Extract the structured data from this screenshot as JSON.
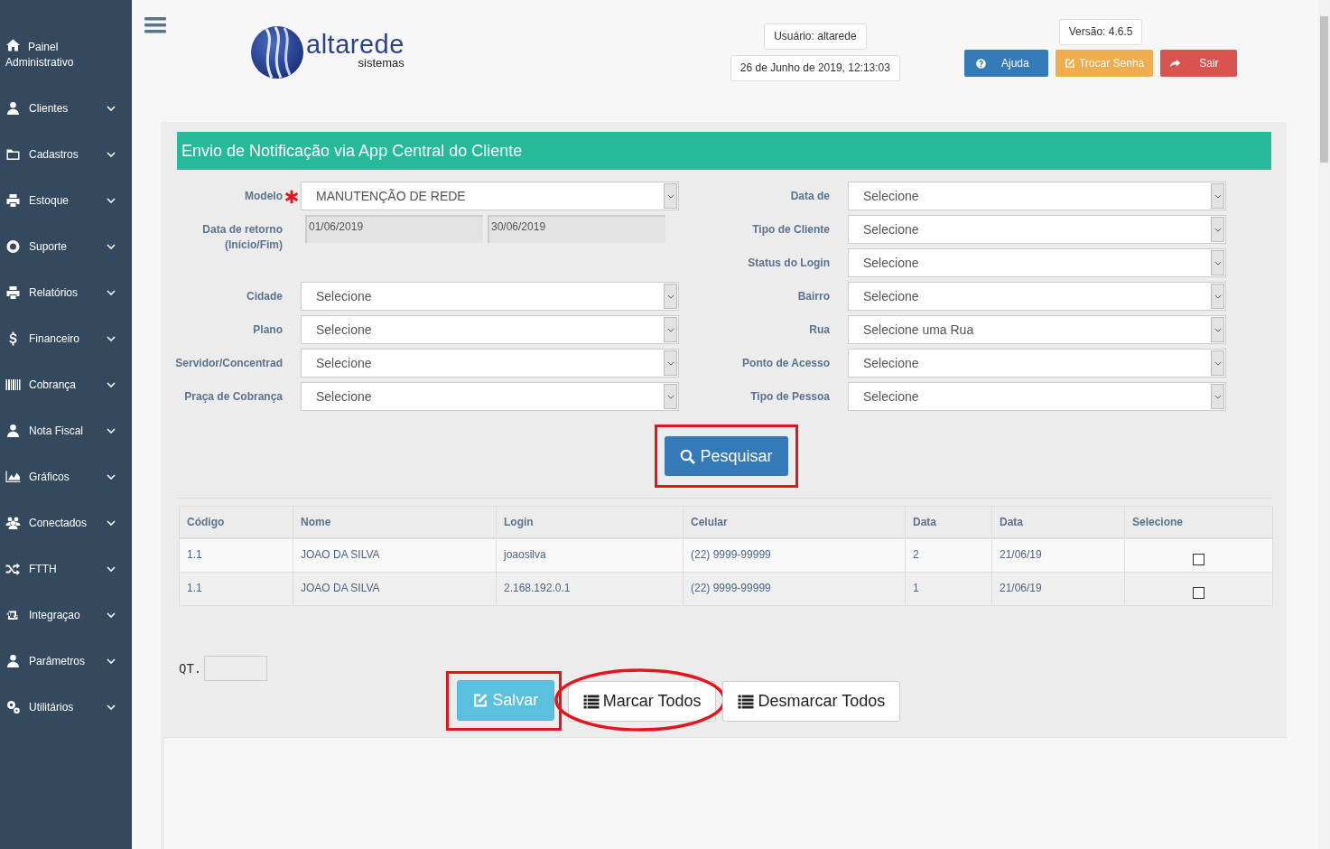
{
  "sidebar": {
    "items": [
      {
        "label": "Painel Administrativo",
        "has_submenu": false
      },
      {
        "label": "Clientes",
        "has_submenu": true
      },
      {
        "label": "Cadastros",
        "has_submenu": true
      },
      {
        "label": "Estoque",
        "has_submenu": true
      },
      {
        "label": "Suporte",
        "has_submenu": true
      },
      {
        "label": "Relatórios",
        "has_submenu": true
      },
      {
        "label": "Financeiro",
        "has_submenu": true
      },
      {
        "label": "Cobrança",
        "has_submenu": true
      },
      {
        "label": "Nota Fiscal",
        "has_submenu": true
      },
      {
        "label": "Gráficos",
        "has_submenu": true
      },
      {
        "label": "Conectados",
        "has_submenu": true
      },
      {
        "label": "FTTH",
        "has_submenu": true
      },
      {
        "label": "Integraçao",
        "has_submenu": true
      },
      {
        "label": "Parâmetros",
        "has_submenu": true
      },
      {
        "label": "Utilitários",
        "has_submenu": true
      }
    ]
  },
  "header": {
    "logo": {
      "name": "altarede",
      "tagline": "sistemas"
    },
    "user": "Usuário: altarede",
    "datetime": "26 de Junho de 2019, 12:13:03",
    "version": "Versão: 4.6.5",
    "buttons": [
      {
        "label": "Ajuda",
        "kind": "help"
      },
      {
        "label": "Trocar Senha",
        "kind": "password"
      },
      {
        "label": "Sair",
        "kind": "logout"
      }
    ]
  },
  "panel": {
    "title": "Envio de Notificação via App Central do Cliente",
    "left_fields": [
      {
        "kind": "select",
        "label": "Modelo",
        "required": true,
        "value": "MANUTENÇÃO DE REDE"
      },
      {
        "kind": "date_range",
        "label": "Data de retorno (Início/Fim)",
        "start": "01/06/2019",
        "end": "30/06/2019"
      },
      {
        "kind": "select",
        "label": "Cidade",
        "required": false,
        "value": "Selecione"
      },
      {
        "kind": "select",
        "label": "Plano",
        "required": false,
        "value": "Selecione"
      },
      {
        "kind": "select",
        "label": "Servidor/Concentrad",
        "required": false,
        "value": "Selecione"
      },
      {
        "kind": "select",
        "label": "Praça de Cobrança",
        "required": false,
        "value": "Selecione"
      }
    ],
    "right_fields": [
      {
        "kind": "select",
        "label": "Data de",
        "required": false,
        "value": "Selecione"
      },
      {
        "kind": "select",
        "label": "Tipo de Cliente",
        "required": false,
        "value": "Selecione"
      },
      {
        "kind": "select",
        "label": "Status do Login",
        "required": false,
        "value": "Selecione"
      },
      {
        "kind": "select",
        "label": "Bairro",
        "required": false,
        "value": "Selecione"
      },
      {
        "kind": "select",
        "label": "Rua",
        "required": false,
        "value": "Selecione uma Rua"
      },
      {
        "kind": "select",
        "label": "Ponto de Acesso",
        "required": false,
        "value": "Selecione"
      },
      {
        "kind": "select",
        "label": "Tipo de Pessoa",
        "required": false,
        "value": "Selecione"
      }
    ],
    "search_button": {
      "label": "Pesquisar",
      "highlighted": true
    },
    "table": {
      "columns": [
        "Código",
        "Nome",
        "Login",
        "Celular",
        "Data",
        "Data",
        "Selecione"
      ],
      "rows": [
        {
          "cells": [
            "1.1",
            "JOAO DA SILVA",
            "joaosilva",
            "(22) 9999-99999",
            "2",
            "21/06/19"
          ],
          "checked": false
        },
        {
          "cells": [
            "1.1",
            "JOAO DA SILVA",
            "2.168.192.0.1",
            "(22) 9999-99999",
            "1",
            "21/06/19"
          ],
          "checked": false
        }
      ]
    },
    "quantity_label": "QT.",
    "actions": [
      {
        "label": "Salvar",
        "kind": "save",
        "boxed": true,
        "circled": false
      },
      {
        "label": "Marcar Todos",
        "kind": "list",
        "boxed": false,
        "circled": true
      },
      {
        "label": "Desmarcar Todos",
        "kind": "list",
        "boxed": false,
        "circled": false
      }
    ]
  }
}
